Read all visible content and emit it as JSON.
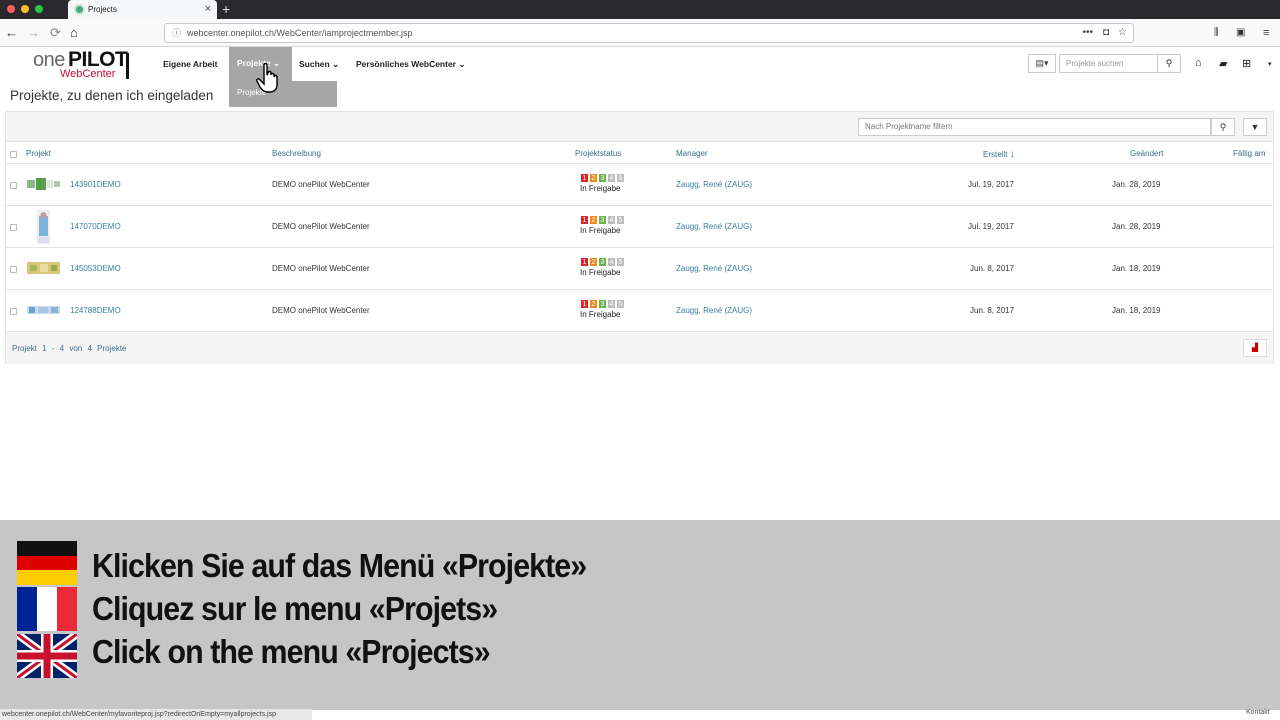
{
  "browser": {
    "tab_title": "Projects",
    "url": "webcenter.onepilot.ch/WebCenter/iamprojectmember.jsp",
    "status_url": "webcenter.onepilot.ch/WebCenter/myfavoriteproj.jsp?redirectOnEmpty=myallprojects.jsp"
  },
  "logo": {
    "one": "one",
    "pilot": "PILOT",
    "webcenter": "WebCenter"
  },
  "nav": {
    "eigene_arbeit": "Eigene Arbeit",
    "projekte": "Projekte",
    "suchen": "Suchen",
    "persoenlich": "Persönliches WebCenter",
    "dropdown_item": "Projekte"
  },
  "header": {
    "search_placeholder": "Projekte suchen"
  },
  "page": {
    "title": "Projekte, zu denen ich eingeladen"
  },
  "table": {
    "filter_placeholder": "Nach Projektname filtern",
    "columns": {
      "projekt": "Projekt",
      "beschreibung": "Beschreibung",
      "projektstatus": "Projektstatus",
      "manager": "Manager",
      "erstellt": "Erstellt",
      "geaendert": "Geändert",
      "faellig": "Fällig am"
    },
    "rows": [
      {
        "name": "143901DEMO",
        "description": "DEMO onePilot WebCenter",
        "status": "In Freigabe",
        "manager": "Zaugg, René (ZAUG)",
        "created": "Jul. 19, 2017",
        "changed": "Jan. 28, 2019"
      },
      {
        "name": "147070DEMO",
        "description": "DEMO onePilot WebCenter",
        "status": "In Freigabe",
        "manager": "Zaugg, René (ZAUG)",
        "created": "Jul. 19, 2017",
        "changed": "Jan. 28, 2019"
      },
      {
        "name": "145053DEMO",
        "description": "DEMO onePilot WebCenter",
        "status": "In Freigabe",
        "manager": "Zaugg, René (ZAUG)",
        "created": "Jun. 8, 2017",
        "changed": "Jan. 18, 2019"
      },
      {
        "name": "124788DEMO",
        "description": "DEMO onePilot WebCenter",
        "status": "In Freigabe",
        "manager": "Zaugg, René (ZAUG)",
        "created": "Jun. 8, 2017",
        "changed": "Jan. 18, 2019"
      }
    ],
    "steps": [
      "1",
      "2",
      "3",
      "4",
      "5"
    ],
    "pager": "Projekt 1 - 4 von 4 Projekte"
  },
  "captions": {
    "de": "Klicken Sie auf das Menü «Projekte»",
    "fr": "Cliquez sur le menu «Projets»",
    "en": "Click on the menu «Projects»"
  },
  "footer": {
    "kontakt": "Kontakt"
  },
  "colors": {
    "step1": "#d9252b",
    "step2": "#f08a1c",
    "step3": "#6ab34a",
    "step_off": "#bdbdbd",
    "brand_red": "#c8102e"
  }
}
